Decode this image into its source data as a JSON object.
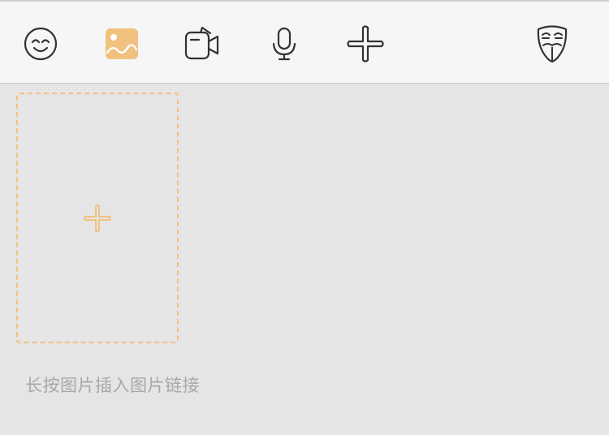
{
  "toolbar": {
    "items": [
      {
        "icon": "smiley-icon",
        "active": false
      },
      {
        "icon": "image-icon",
        "active": true
      },
      {
        "icon": "video-camera-icon",
        "active": false
      },
      {
        "icon": "microphone-icon",
        "active": false
      },
      {
        "icon": "plus-icon",
        "active": false
      },
      {
        "icon": "anonymous-mask-icon",
        "active": false
      }
    ]
  },
  "image_panel": {
    "add_tile_icon": "plus-icon",
    "hint_text": "长按图片插入图片链接"
  },
  "colors": {
    "accent": "#f0c17f",
    "icon": "#333333",
    "toolbar_bg": "#f7f6f7",
    "panel_bg": "#e5e5e5",
    "hint_text": "#a8a8a8"
  }
}
